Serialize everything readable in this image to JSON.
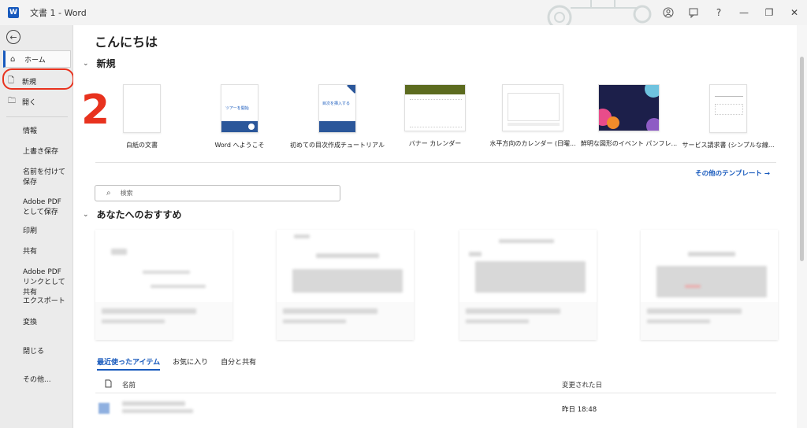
{
  "titlebar": {
    "app_letter": "W",
    "document_title": "文書 1  -  Word",
    "help": "?",
    "minimize": "—",
    "restore": "❐",
    "close": "✕"
  },
  "sidebar": {
    "back": "←",
    "items": [
      {
        "label": "ホーム",
        "icon": "⌂"
      },
      {
        "label": "新規",
        "icon": "🗋"
      },
      {
        "label": "開く",
        "icon": "🗀"
      }
    ],
    "plain": [
      "情報",
      "上書き保存",
      "名前を付けて保存",
      "Adobe PDF として保存",
      "印刷",
      "共有",
      "Adobe PDF リンクとして共有",
      "エクスポート",
      "変換",
      "閉じる",
      "その他..."
    ]
  },
  "main": {
    "greeting": "こんにちは",
    "new_section": "新規",
    "annotation_number": "2",
    "templates": [
      {
        "label": "白紙の文書"
      },
      {
        "label": "Word へようこそ",
        "thumb_text": "ツアーを開始"
      },
      {
        "label": "初めての目次作成チュートリアル",
        "thumb_text": "目次を挿入する"
      },
      {
        "label": "バナー カレンダー"
      },
      {
        "label": "水平方向のカレンダー (日曜..."
      },
      {
        "label": "鮮明な図形のイベント パンフレ..."
      },
      {
        "label": "サービス請求書 (シンプルな線..."
      }
    ],
    "more_templates": "その他のテンプレート →",
    "search_placeholder": "検索",
    "recommended_section": "あなたへのおすすめ",
    "tabs": [
      "最近使ったアイテム",
      "お気に入り",
      "自分と共有"
    ],
    "columns": {
      "name": "名前",
      "modified": "変更された日"
    },
    "files": [
      {
        "modified": "昨日 18:48"
      }
    ]
  }
}
